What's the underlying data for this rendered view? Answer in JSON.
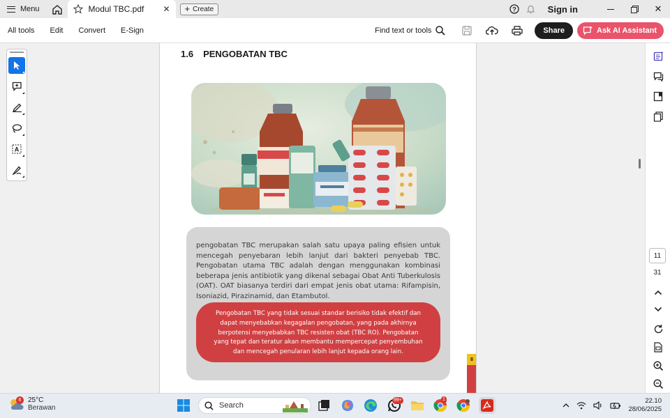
{
  "titlebar": {
    "menu_label": "Menu",
    "tab_title": "Modul TBC.pdf",
    "create_label": "Create",
    "signin_label": "Sign in"
  },
  "toolbar": {
    "menu": [
      "All tools",
      "Edit",
      "Convert",
      "E-Sign"
    ],
    "find_label": "Find text or tools",
    "share_label": "Share",
    "ai_label": "Ask AI Assistant"
  },
  "document": {
    "section_number": "1.6",
    "section_title": "PENGOBATAN TBC",
    "paragraph": "pengobatan TBC merupakan salah satu upaya paling efisien untuk mencegah penyebaran lebih lanjut dari bakteri penyebab TBC. Pengobatan utama TBC adalah dengan menggunakan kombinasi beberapa jenis antibiotik yang dikenal sebagai Obat Anti Tuberkulosis (OAT). OAT biasanya terdiri dari empat jenis obat utama: Rifampisin, Isoniazid, Pirazinamid, dan Etambutol.",
    "callout": "Pengobatan TBC yang tidak sesuai standar berisiko tidak efektif dan dapat menyebabkan kegagalan pengobatan, yang pada akhirnya berpotensi menyebabkan TBC resisten obat (TBC RO). Pengobatan yang tepat dan teratur akan membantu mempercepat penyembuhan dan mencegah penularan lebih lanjut kepada orang lain.",
    "page_tag": "8"
  },
  "pagination": {
    "current": "11",
    "total": "31"
  },
  "taskbar": {
    "weather_badge": "6",
    "temperature": "25°C",
    "condition": "Berawan",
    "search_label": "Search",
    "whatsapp_badge": "99+",
    "chrome_badge": "1",
    "time": "22.10",
    "date": "28/06/2025"
  },
  "colors": {
    "accent": "#1473e6",
    "ai_button": "#e9546b",
    "callout": "#d04042",
    "textbox": "#d5d5d5"
  }
}
